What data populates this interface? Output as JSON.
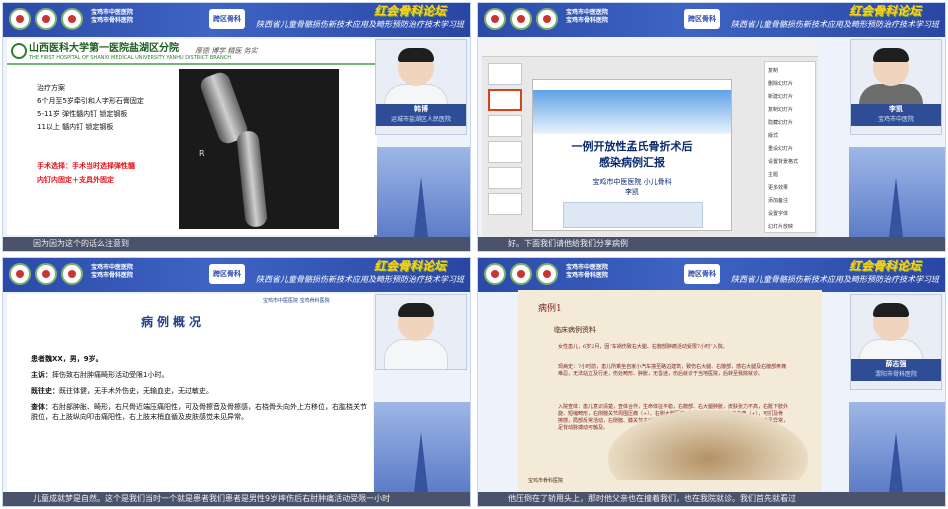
{
  "header": {
    "orgs": [
      "宝鸡市中医医院",
      "宝鸡市骨科医院"
    ],
    "badge": "跨区骨科",
    "forum_title": "红会骨科论坛",
    "course_title": "陕西省儿童骨骼损伤新技术应用及畸形预防治疗技术学习班"
  },
  "panel1": {
    "hospital": "山西医科大学第一医院盐湖区分院",
    "hospital_en": "THE FIRST HOSPITAL OF SHANXI MEDICAL UNIVERSITY YANHU DISTRICT BRANCH",
    "motto": "厚德 博学 精医 务实",
    "lines": [
      "治疗方案",
      "6个月至5岁牵引和人字形石膏固定",
      "5-11岁 弹性髓内钉 锁定钢板",
      "11以上 髓内钉 锁定钢板"
    ],
    "red_lines": [
      "手术选择：手术当时选择弹性髓",
      "内钉内固定＋支具外固定"
    ],
    "xray_mark": "R",
    "speaker_name": "韩博",
    "speaker_hospital": "运城市盐湖区人民医院",
    "caption": "因为因为这个的话么注意到"
  },
  "panel2": {
    "slide_title_1": "一例开放性孟氏骨折术后",
    "slide_title_2": "感染病例汇报",
    "slide_sub": "宝鸡市中医医院 小儿骨科",
    "slide_author": "李凯",
    "menu": [
      "复制",
      "删除幻灯片",
      "新建幻灯片",
      "复制幻灯片",
      "隐藏幻灯片",
      "版式",
      "重设幻灯片",
      "设置背景格式",
      "主题",
      "更多效果",
      "添加备注",
      "设置字体",
      "幻灯片放映",
      "背景音乐"
    ],
    "speaker_name": "李凯",
    "speaker_hospital": "宝鸡市中医院",
    "caption": "好。下面我们请他给我们分享病例"
  },
  "panel3": {
    "title": "病例概况",
    "hospital": "宝鸡市中医医院 宝鸡骨科医院",
    "lines": [
      {
        "label": "患者魏XX，男，9岁。",
        "text": ""
      },
      {
        "label": "主诉：",
        "text": "摔伤致右肘肿痛畸形活动受限1小时。"
      },
      {
        "label": "既往史：",
        "text": "既往体健，无手术外伤史，无输血史，无过敏史。"
      },
      {
        "label": "查体：",
        "text": "右肘部肿胀、畸形，右尺骨近端压痛阳性，可及骨擦音及骨擦感，右桡骨头向外上方移位，右肱桡关节脱位，右上肢纵向叩击痛阳性，右上肢末梢血循及皮肤感觉未见异常。"
      }
    ],
    "caption": "儿童成就梦是自然。这个是我们当时一个就是患者我们患者是男性9岁摔伤后右肘肿痛活动受限一小时"
  },
  "panel4": {
    "case_label": "病例1",
    "heading": "临床病例资料",
    "lines": [
      "女性患儿，6岁2月，因“车祸伤致右大腿、右髋部肿痛活动受限7小时”入院。",
      "现病史：7小时前，患儿所乘坐自家小汽车撞至路边建筑，致伤右大腿、右髋部，感右大腿及右髋部疼痛难忍，无法站立及行走，伤处畸形、肿胀，无昏迷，伤后就诊于当地医院，后转至我院就诊。",
      "入院查体：患儿意识清楚，查体合作，生命体征平稳，右髋部、右大腿肿胀，皮肤张力不高，右骶下肢外旋、短缩畸形，右侧髋关节周围压痛（+），右侧大腿压痛（+），右侧下肢纵向叩击痛（+），可扪及骨擦感，局部反常活动，右侧髋、膝关节主动活动受限，被动活动时疼痛加重，双下肢远端感觉未见异常，足背动脉搏动可触及。"
    ],
    "slide_hospital": "宝鸡市骨科医院",
    "speaker_name": "薛志强",
    "speaker_hospital": "渭阳市骨科医院",
    "caption": "他压倒在了轿用头上，那时他父亲也在撞着我们，也在我院就诊。我们首先就看过"
  }
}
